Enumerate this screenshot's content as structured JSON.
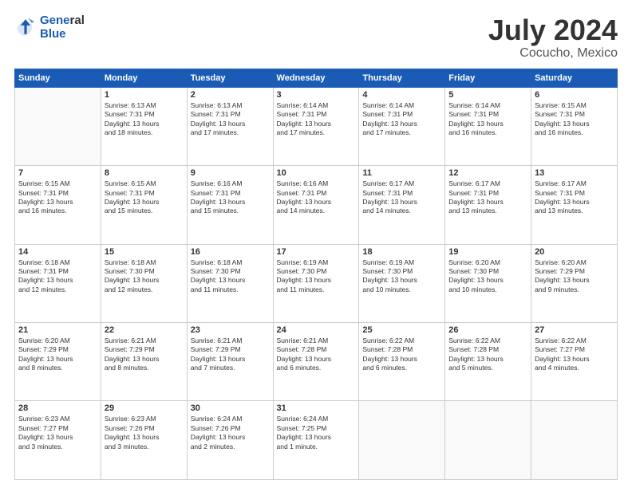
{
  "header": {
    "logo_line1": "General",
    "logo_line2": "Blue",
    "title": "July 2024",
    "subtitle": "Cocucho, Mexico"
  },
  "days_of_week": [
    "Sunday",
    "Monday",
    "Tuesday",
    "Wednesday",
    "Thursday",
    "Friday",
    "Saturday"
  ],
  "weeks": [
    [
      {
        "day": "",
        "info": ""
      },
      {
        "day": "1",
        "info": "Sunrise: 6:13 AM\nSunset: 7:31 PM\nDaylight: 13 hours\nand 18 minutes."
      },
      {
        "day": "2",
        "info": "Sunrise: 6:13 AM\nSunset: 7:31 PM\nDaylight: 13 hours\nand 17 minutes."
      },
      {
        "day": "3",
        "info": "Sunrise: 6:14 AM\nSunset: 7:31 PM\nDaylight: 13 hours\nand 17 minutes."
      },
      {
        "day": "4",
        "info": "Sunrise: 6:14 AM\nSunset: 7:31 PM\nDaylight: 13 hours\nand 17 minutes."
      },
      {
        "day": "5",
        "info": "Sunrise: 6:14 AM\nSunset: 7:31 PM\nDaylight: 13 hours\nand 16 minutes."
      },
      {
        "day": "6",
        "info": "Sunrise: 6:15 AM\nSunset: 7:31 PM\nDaylight: 13 hours\nand 16 minutes."
      }
    ],
    [
      {
        "day": "7",
        "info": "Sunrise: 6:15 AM\nSunset: 7:31 PM\nDaylight: 13 hours\nand 16 minutes."
      },
      {
        "day": "8",
        "info": "Sunrise: 6:15 AM\nSunset: 7:31 PM\nDaylight: 13 hours\nand 15 minutes."
      },
      {
        "day": "9",
        "info": "Sunrise: 6:16 AM\nSunset: 7:31 PM\nDaylight: 13 hours\nand 15 minutes."
      },
      {
        "day": "10",
        "info": "Sunrise: 6:16 AM\nSunset: 7:31 PM\nDaylight: 13 hours\nand 14 minutes."
      },
      {
        "day": "11",
        "info": "Sunrise: 6:17 AM\nSunset: 7:31 PM\nDaylight: 13 hours\nand 14 minutes."
      },
      {
        "day": "12",
        "info": "Sunrise: 6:17 AM\nSunset: 7:31 PM\nDaylight: 13 hours\nand 13 minutes."
      },
      {
        "day": "13",
        "info": "Sunrise: 6:17 AM\nSunset: 7:31 PM\nDaylight: 13 hours\nand 13 minutes."
      }
    ],
    [
      {
        "day": "14",
        "info": "Sunrise: 6:18 AM\nSunset: 7:31 PM\nDaylight: 13 hours\nand 12 minutes."
      },
      {
        "day": "15",
        "info": "Sunrise: 6:18 AM\nSunset: 7:30 PM\nDaylight: 13 hours\nand 12 minutes."
      },
      {
        "day": "16",
        "info": "Sunrise: 6:18 AM\nSunset: 7:30 PM\nDaylight: 13 hours\nand 11 minutes."
      },
      {
        "day": "17",
        "info": "Sunrise: 6:19 AM\nSunset: 7:30 PM\nDaylight: 13 hours\nand 11 minutes."
      },
      {
        "day": "18",
        "info": "Sunrise: 6:19 AM\nSunset: 7:30 PM\nDaylight: 13 hours\nand 10 minutes."
      },
      {
        "day": "19",
        "info": "Sunrise: 6:20 AM\nSunset: 7:30 PM\nDaylight: 13 hours\nand 10 minutes."
      },
      {
        "day": "20",
        "info": "Sunrise: 6:20 AM\nSunset: 7:29 PM\nDaylight: 13 hours\nand 9 minutes."
      }
    ],
    [
      {
        "day": "21",
        "info": "Sunrise: 6:20 AM\nSunset: 7:29 PM\nDaylight: 13 hours\nand 8 minutes."
      },
      {
        "day": "22",
        "info": "Sunrise: 6:21 AM\nSunset: 7:29 PM\nDaylight: 13 hours\nand 8 minutes."
      },
      {
        "day": "23",
        "info": "Sunrise: 6:21 AM\nSunset: 7:29 PM\nDaylight: 13 hours\nand 7 minutes."
      },
      {
        "day": "24",
        "info": "Sunrise: 6:21 AM\nSunset: 7:28 PM\nDaylight: 13 hours\nand 6 minutes."
      },
      {
        "day": "25",
        "info": "Sunrise: 6:22 AM\nSunset: 7:28 PM\nDaylight: 13 hours\nand 6 minutes."
      },
      {
        "day": "26",
        "info": "Sunrise: 6:22 AM\nSunset: 7:28 PM\nDaylight: 13 hours\nand 5 minutes."
      },
      {
        "day": "27",
        "info": "Sunrise: 6:22 AM\nSunset: 7:27 PM\nDaylight: 13 hours\nand 4 minutes."
      }
    ],
    [
      {
        "day": "28",
        "info": "Sunrise: 6:23 AM\nSunset: 7:27 PM\nDaylight: 13 hours\nand 3 minutes."
      },
      {
        "day": "29",
        "info": "Sunrise: 6:23 AM\nSunset: 7:26 PM\nDaylight: 13 hours\nand 3 minutes."
      },
      {
        "day": "30",
        "info": "Sunrise: 6:24 AM\nSunset: 7:26 PM\nDaylight: 13 hours\nand 2 minutes."
      },
      {
        "day": "31",
        "info": "Sunrise: 6:24 AM\nSunset: 7:25 PM\nDaylight: 13 hours\nand 1 minute."
      },
      {
        "day": "",
        "info": ""
      },
      {
        "day": "",
        "info": ""
      },
      {
        "day": "",
        "info": ""
      }
    ]
  ]
}
